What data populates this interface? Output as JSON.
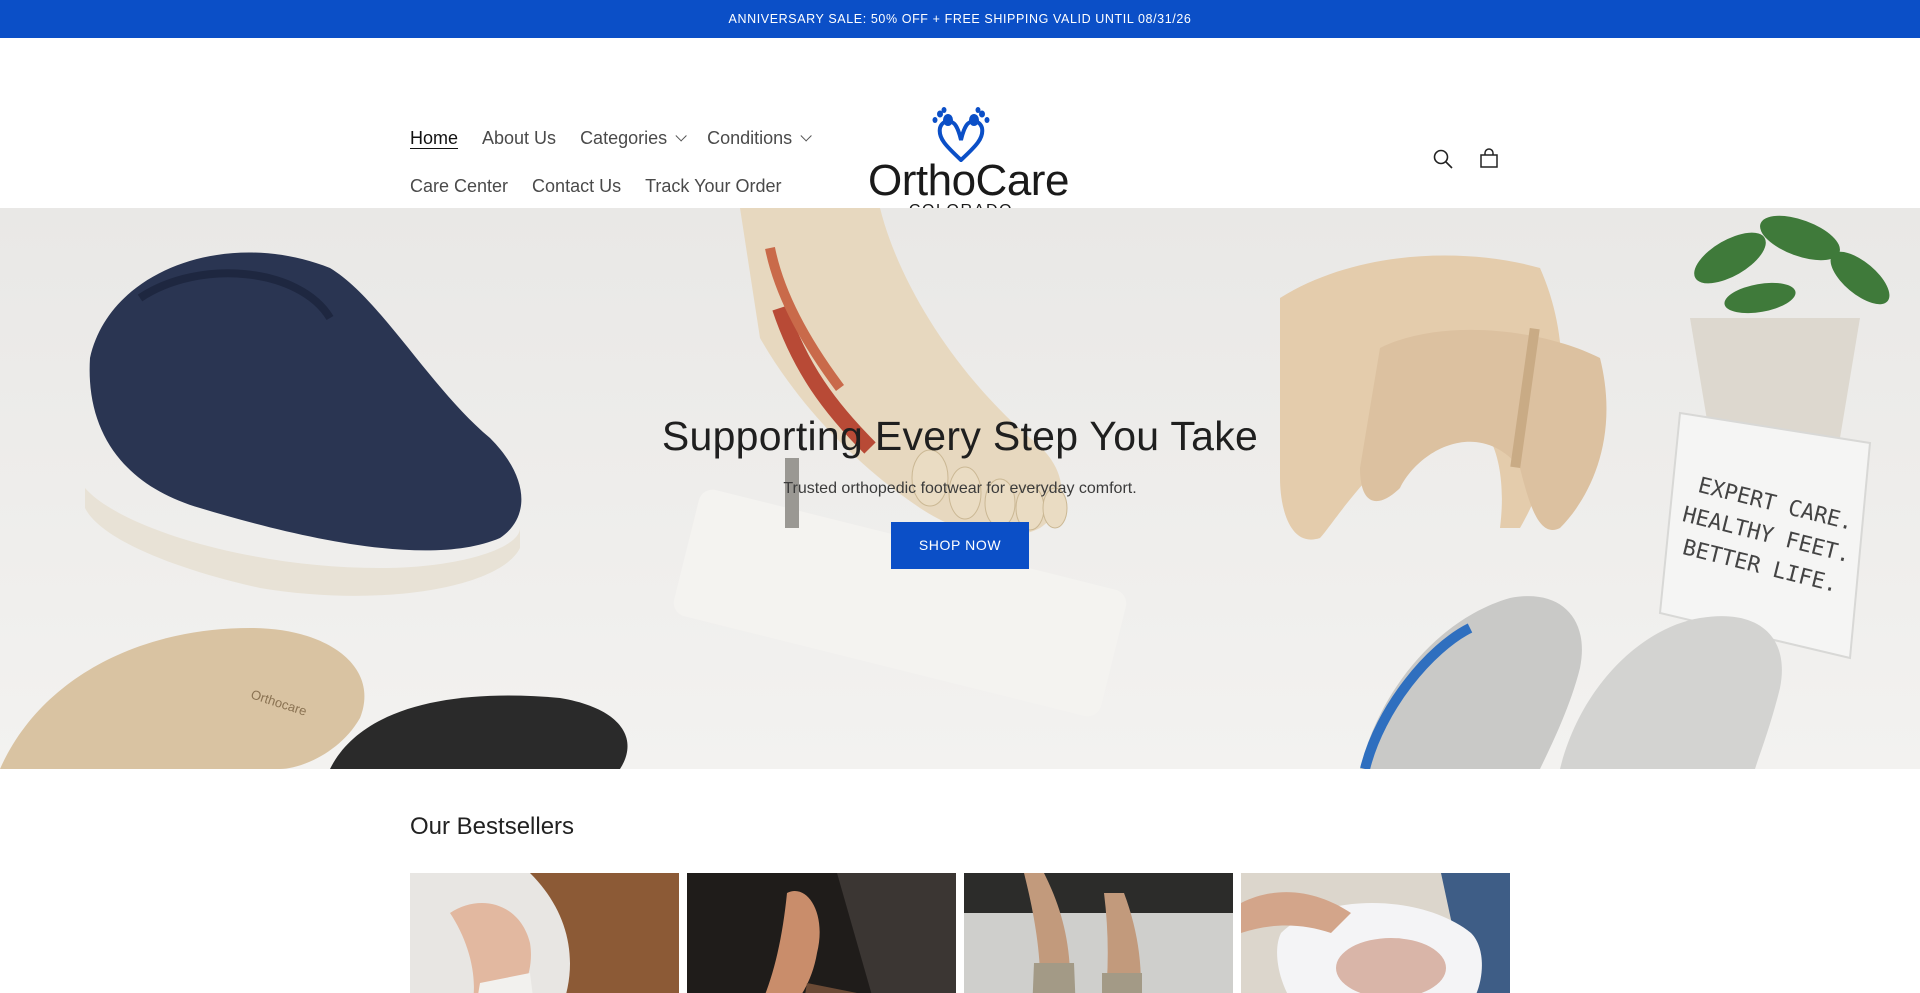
{
  "announcement": {
    "text": "ANNIVERSARY SALE: 50% OFF + FREE SHIPPING VALID UNTIL 08/31/26"
  },
  "nav": {
    "row1": [
      {
        "label": "Home",
        "active": true
      },
      {
        "label": "About Us"
      },
      {
        "label": "Categories",
        "dropdown": true
      },
      {
        "label": "Conditions",
        "dropdown": true
      }
    ],
    "row2": [
      {
        "label": "Care Center"
      },
      {
        "label": "Contact Us"
      },
      {
        "label": "Track Your Order"
      }
    ]
  },
  "logo": {
    "title": "OrthoCare",
    "subtitle": "COLORADO"
  },
  "header_icons": [
    "search-icon",
    "cart-icon"
  ],
  "hero": {
    "title": "Supporting Every Step You Take",
    "subtitle": "Trusted orthopedic footwear for everyday comfort.",
    "cta": "SHOP NOW",
    "sign_text": [
      "EXPERT CARE.",
      "HEALTHY FEET.",
      "BETTER LIFE."
    ],
    "insole_brand": "Orthocare"
  },
  "bestsellers": {
    "title": "Our Bestsellers"
  },
  "colors": {
    "brand_blue": "#0b4fc7",
    "text_dark": "#1f1f1f"
  }
}
